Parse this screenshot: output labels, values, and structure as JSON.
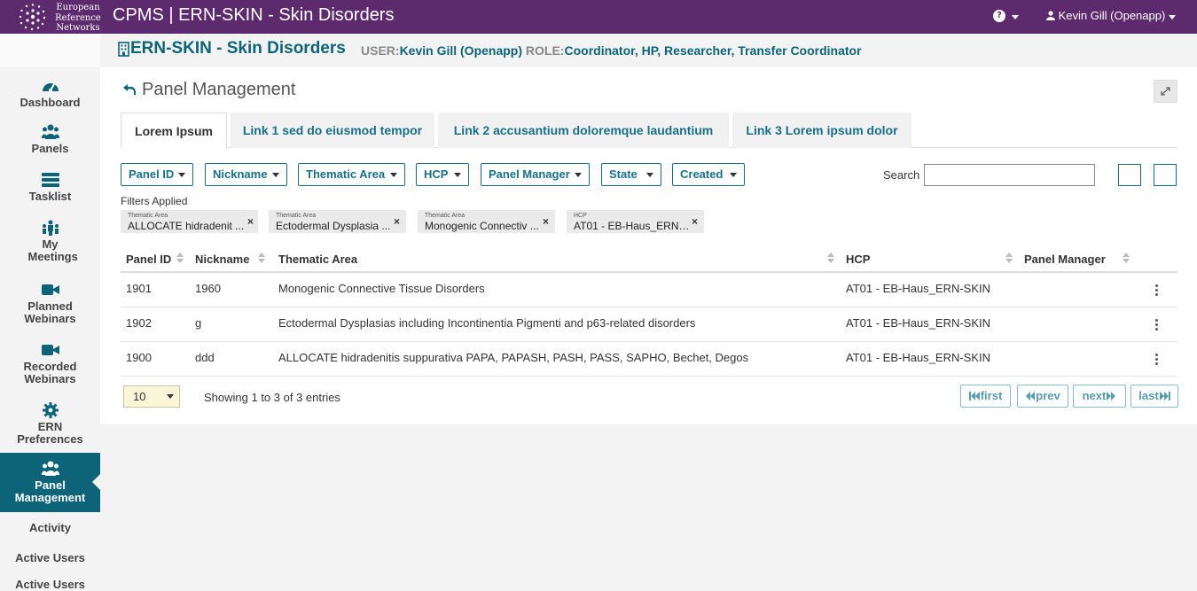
{
  "brand": {
    "logo_text": [
      "European",
      "Reference",
      "Networks"
    ],
    "app_title": "CPMS | ERN-SKIN - Skin Disorders",
    "help_icon": "question-circle-icon",
    "user_name": "Kevin Gill (Openapp)"
  },
  "header": {
    "title": "ERN-SKIN - Skin Disorders",
    "user_key": "USER:",
    "user_value": "Kevin Gill (Openapp)",
    "role_key": "ROLE:",
    "role_value": "Coordinator, HP, Researcher, Transfer Coordinator"
  },
  "sidebar": {
    "items": [
      {
        "label": "Dashboard",
        "icon": "gauge-icon"
      },
      {
        "label": "Panels",
        "icon": "users-icon"
      },
      {
        "label": "Tasklist",
        "icon": "tasklist-icon"
      },
      {
        "label": "My Meetings",
        "icon": "meetings-icon"
      },
      {
        "label": "Planned Webinars",
        "icon": "video-camera-icon"
      },
      {
        "label": "Recorded Webinars",
        "icon": "video-camera-icon"
      },
      {
        "label": "ERN Preferences",
        "icon": "gear-icon"
      },
      {
        "label": "Panel Management",
        "icon": "users-icon",
        "active": true
      },
      {
        "label": "Activity"
      },
      {
        "label": "Active Users"
      },
      {
        "label": "Active Users"
      }
    ]
  },
  "main": {
    "title": "Panel Management",
    "tabs": [
      {
        "label": "Lorem Ipsum",
        "active": true
      },
      {
        "label": "Link 1 sed do eiusmod tempor"
      },
      {
        "label": "Link 2 accusantium doloremque laudantium"
      },
      {
        "label": "Link 3 Lorem ipsum dolor"
      }
    ],
    "filter_buttons": [
      "Panel ID",
      "Nickname",
      "Thematic Area",
      "HCP",
      "Panel Manager",
      "State",
      "Created"
    ],
    "search_label": "Search",
    "search_value": "",
    "filters_applied_label": "Filters Applied",
    "chips": [
      {
        "category": "Thematic Area",
        "value": "ALLOCATE hidradenit ..."
      },
      {
        "category": "Thematic Area",
        "value": "Ectodermal Dysplasia ..."
      },
      {
        "category": "Thematic Area",
        "value": "Monogenic Connectiv ..."
      },
      {
        "category": "HCP",
        "value": "AT01 - EB-Haus_ERN- ..."
      }
    ],
    "chip_remove": "×",
    "table": {
      "columns": [
        "Panel ID",
        "Nickname",
        "Thematic Area",
        "HCP",
        "Panel Manager"
      ],
      "rows": [
        {
          "id": "1901",
          "nickname": "1960",
          "area": "Monogenic Connective Tissue Disorders",
          "hcp": "AT01 - EB-Haus_ERN-SKIN",
          "manager": ""
        },
        {
          "id": "1902",
          "nickname": "g",
          "area": "Ectodermal Dysplasias including Incontinentia Pigmenti and p63-related disorders",
          "hcp": "AT01 - EB-Haus_ERN-SKIN",
          "manager": ""
        },
        {
          "id": "1900",
          "nickname": "ddd",
          "area": "ALLOCATE hidradenitis suppurativa PAPA, PAPASH, PASH, PASS, SAPHO, Bechet, Degos",
          "hcp": "AT01 - EB-Haus_ERN-SKIN",
          "manager": ""
        }
      ]
    },
    "page_size": "10",
    "showing": "Showing 1 to 3 of 3 entries",
    "pagination": {
      "first": "first",
      "prev": "prev",
      "next": "next",
      "last": "last"
    }
  },
  "colors": {
    "topbar": "#5e2a6e",
    "accent": "#0d6377",
    "link": "#1a6f87"
  }
}
